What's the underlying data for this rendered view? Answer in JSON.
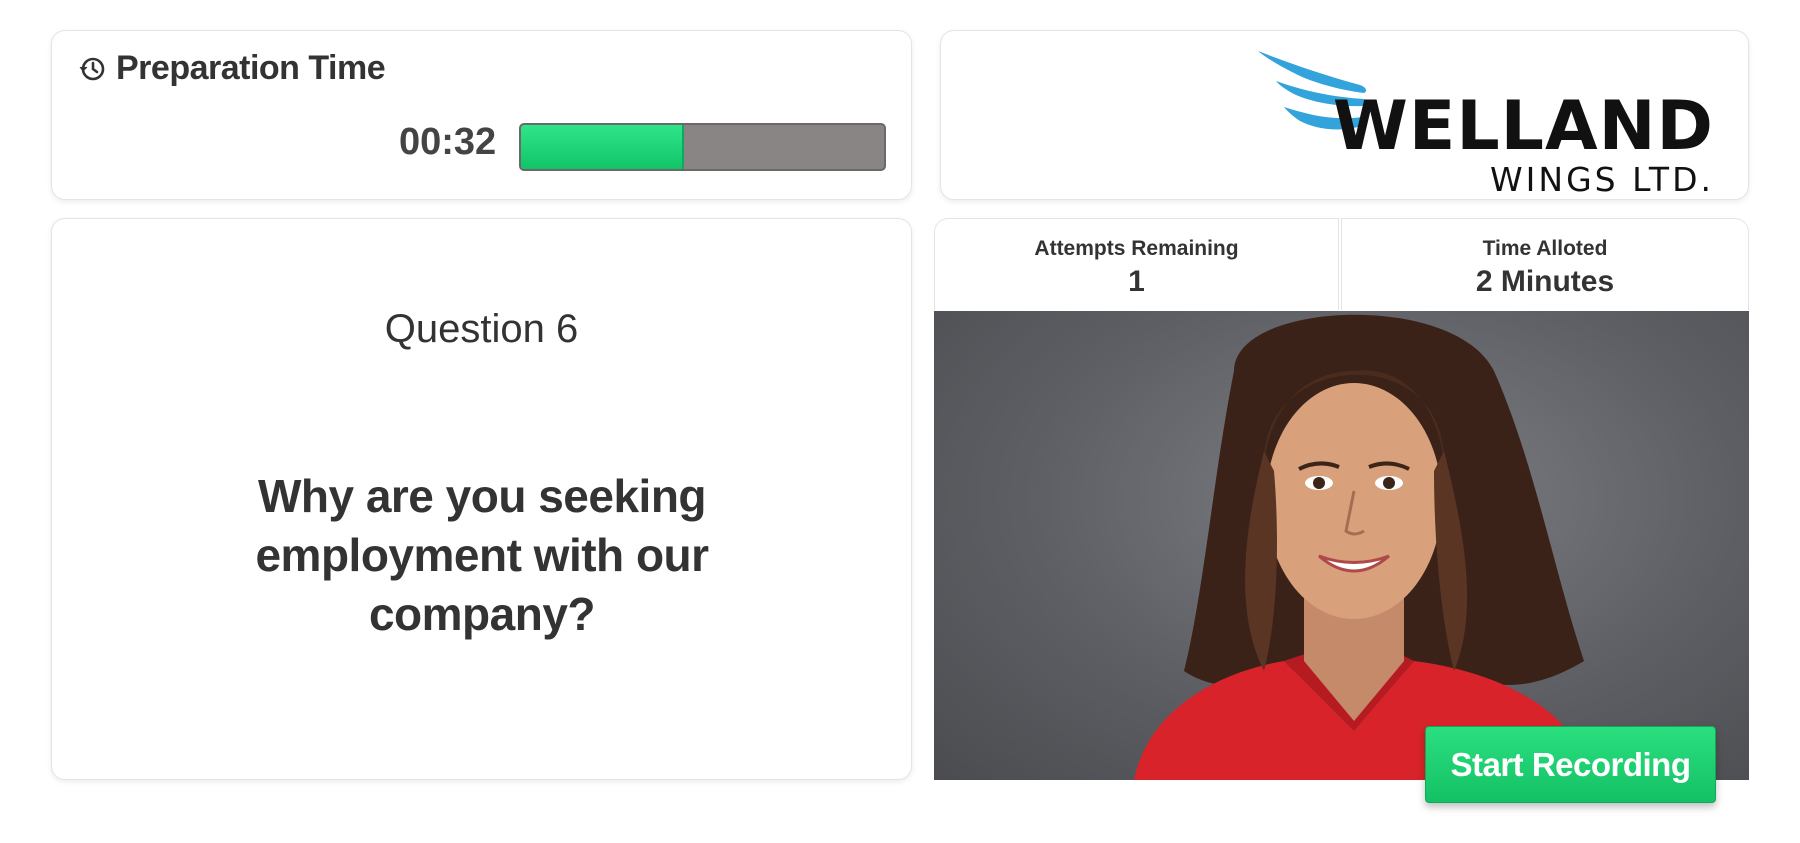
{
  "preparation": {
    "title": "Preparation Time",
    "icon": "clock-history-icon",
    "timer": "00:32",
    "progress_fraction": 0.45,
    "progress_color": "#18d16f"
  },
  "brand": {
    "name": "WELLAND",
    "subtitle": "WINGS LTD.",
    "logo_icon": "wings-logo-icon",
    "wing_color": "#33a3dc"
  },
  "question": {
    "number_label": "Question 6",
    "text": "Why are you seeking employment with our company?"
  },
  "stats": {
    "attempts_label": "Attempts Remaining",
    "attempts_value": "1",
    "time_label": "Time Alloted",
    "time_value": "2 Minutes"
  },
  "video": {
    "subject": "candidate-video-preview"
  },
  "actions": {
    "record_label": "Start Recording",
    "record_color": "#1cc96d"
  }
}
